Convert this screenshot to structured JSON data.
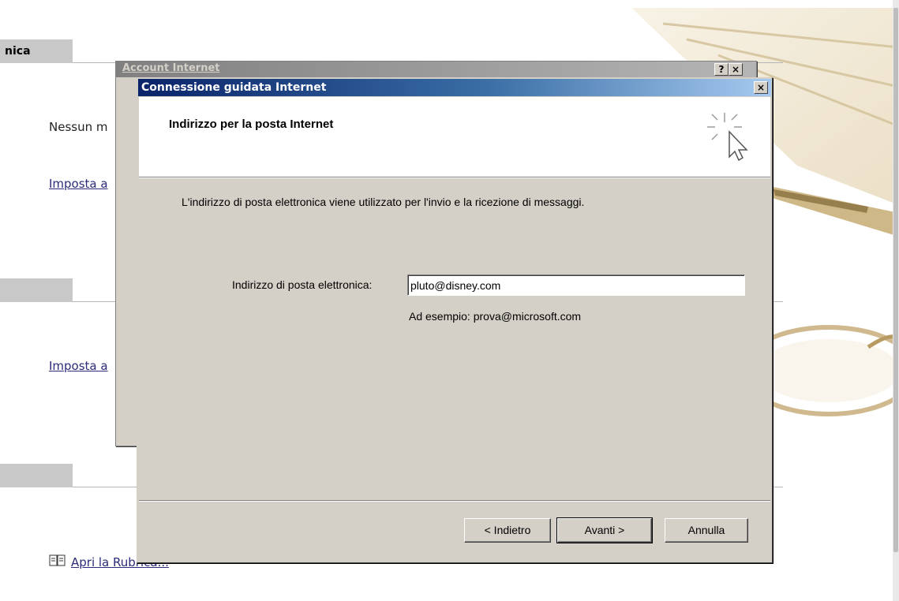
{
  "background_page": {
    "section1_title": "nica",
    "no_account_text": "Nessun m",
    "setup_link_1": "Imposta a",
    "setup_link_2": "Imposta a",
    "address_book_link": "Apri la Rubrica..."
  },
  "account_dialog": {
    "title": "Account Internet",
    "help_button": "?",
    "close_button": "×"
  },
  "wizard": {
    "title": "Connessione guidata Internet",
    "close_button": "×",
    "header_title": "Indirizzo per la posta Internet",
    "icon": "wizard-sparkle-cursor-icon",
    "description": "L'indirizzo di posta elettronica viene utilizzato per l'invio e la ricezione di messaggi.",
    "email_label": "Indirizzo di posta elettronica:",
    "email_value": "pluto@disney.com",
    "example_text": "Ad esempio: prova@microsoft.com",
    "buttons": {
      "back": "< Indietro",
      "next": "Avanti >",
      "cancel": "Annulla"
    }
  },
  "colors": {
    "dialog_face": "#d4d0c8",
    "titlebar_active_start": "#0a246a",
    "titlebar_active_end": "#a6caf0",
    "titlebar_inactive": "#808080"
  }
}
